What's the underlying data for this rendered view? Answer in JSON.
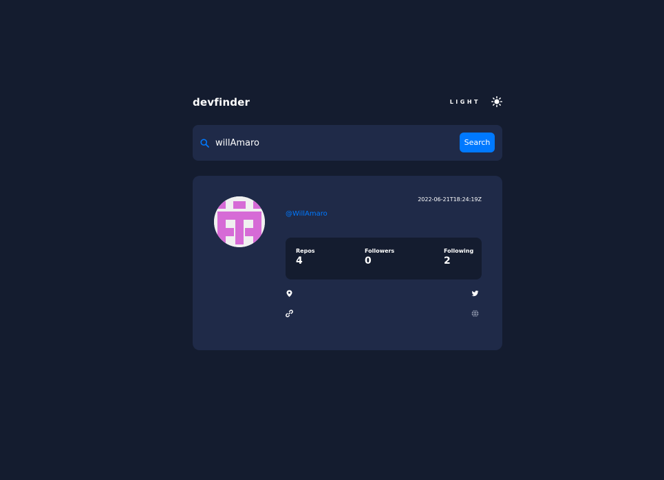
{
  "app": {
    "logo": "devfinder",
    "theme_toggle_label": "LIGHT",
    "theme_icon": "sun-icon"
  },
  "search": {
    "value": "willAmaro",
    "button_label": "Search",
    "icon": "search-icon"
  },
  "profile": {
    "joined": "2022-06-21T18:24:19Z",
    "login": "@WillAmaro",
    "avatar_color": "#d66bd6",
    "stats": [
      {
        "label": "Repos",
        "value": "4"
      },
      {
        "label": "Followers",
        "value": "0"
      },
      {
        "label": "Following",
        "value": "2"
      }
    ],
    "links": {
      "location_icon": "location-pin-icon",
      "twitter_icon": "twitter-icon",
      "website_icon": "link-icon",
      "company_icon": "globe-icon"
    }
  },
  "colors": {
    "background": "#141c2f",
    "card": "#1f2a48",
    "accent": "#0079ff"
  }
}
